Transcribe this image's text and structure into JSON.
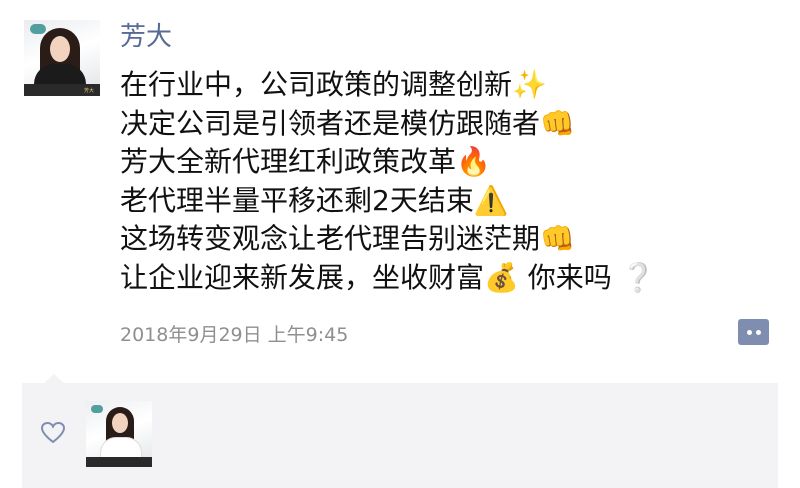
{
  "post": {
    "username": "芳大",
    "lines": [
      {
        "text": "在行业中，公司政策的调整创新",
        "emoji": "✨"
      },
      {
        "text": "决定公司是引领者还是模仿跟随者",
        "emoji": "👊"
      },
      {
        "text": "芳大全新代理红利政策改革",
        "emoji": "🔥"
      },
      {
        "text": "老代理半量平移还剩2天结束",
        "emoji": "⚠️"
      },
      {
        "text": "这场转变观念让老代理告别迷茫期",
        "emoji": "👊"
      },
      {
        "text": "让企业迎来新发展，坐收财富",
        "emoji": "💰",
        "tail": "你来吗",
        "tail_emoji": "❔"
      }
    ],
    "timestamp": "2018年9月29日 上午9:45",
    "avatar_caption": "芳大"
  },
  "icons": {
    "comment": "comment-icon",
    "like": "heart-icon"
  },
  "colors": {
    "username": "#576b95",
    "comment_button": "#7f8eb0",
    "panel_bg": "#f3f3f5",
    "timestamp": "#8f8f8f"
  }
}
